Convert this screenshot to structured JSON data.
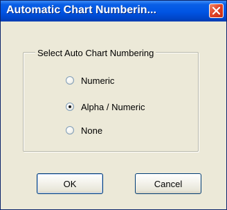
{
  "window": {
    "title": "Automatic Chart Numberin...",
    "close_icon": "close-icon"
  },
  "group": {
    "legend": "Select Auto Chart Numbering",
    "options": [
      {
        "label": "Numeric",
        "selected": false
      },
      {
        "label": "Alpha / Numeric",
        "selected": true
      },
      {
        "label": "None",
        "selected": false
      }
    ]
  },
  "buttons": {
    "ok_label": "OK",
    "cancel_label": "Cancel"
  },
  "colors": {
    "titlebar": "#0054e3",
    "dialog_background": "#ece9d8",
    "close_button": "#e0452a"
  }
}
